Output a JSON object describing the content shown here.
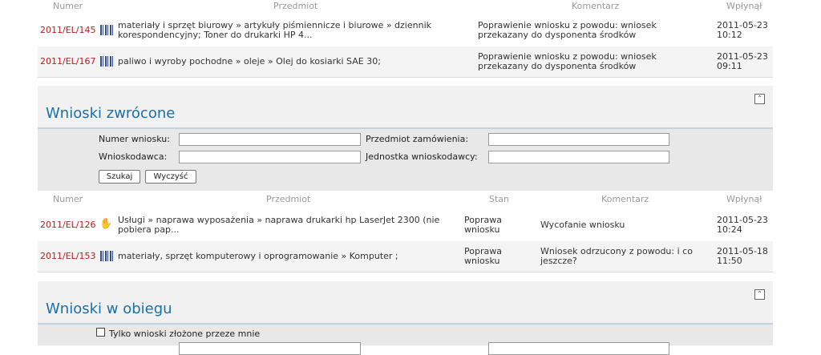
{
  "top_table": {
    "headers": {
      "numer": "Numer",
      "przedmiot": "Przedmiot",
      "komentarz": "Komentarz",
      "wplynal": "Wpłynął"
    },
    "rows": [
      {
        "numer": "2011/EL/145",
        "icon": "barcode-icon",
        "przedmiot_1": "materiały i sprzęt biurowy » artykuły piśmiennicze i biurowe » dziennik",
        "przedmiot_2": "korespondencyjny; Toner do drukarki HP 4...",
        "komentarz_1": "Poprawienie wniosku z powodu: wniosek",
        "komentarz_2": "przekazany do dysponenta środków",
        "date": "2011-05-23",
        "time": "10:12"
      },
      {
        "numer": "2011/EL/167",
        "icon": "barcode-icon",
        "przedmiot_1": "paliwo i wyroby pochodne » oleje » Olej do kosiarki SAE 30;",
        "przedmiot_2": "",
        "komentarz_1": "Poprawienie wniosku z powodu: wniosek",
        "komentarz_2": "przekazany do dysponenta środków",
        "date": "2011-05-23",
        "time": "09:11"
      }
    ]
  },
  "section_zwrocone": {
    "title": "Wnioski zwrócone",
    "collapse_icon": "double-chevron-up-icon",
    "filters": {
      "numer_label": "Numer wniosku:",
      "przedmiot_label": "Przedmiot zamówienia:",
      "wnioskodawca_label": "Wnioskodawca:",
      "jednostka_label": "Jednostka wnioskodawcy:",
      "numer_value": "",
      "przedmiot_value": "",
      "wnioskodawca_value": "",
      "jednostka_value": "",
      "search_button": "Szukaj",
      "clear_button": "Wyczyść"
    },
    "headers": {
      "numer": "Numer",
      "przedmiot": "Przedmiot",
      "stan": "Stan",
      "komentarz": "Komentarz",
      "wplynal": "Wpłynął"
    },
    "rows": [
      {
        "numer": "2011/EL/126",
        "icon": "hand-icon",
        "przedmiot_1": "Usługi » naprawa wyposażenia » naprawa drukarki hp LaserJet 2300 (nie",
        "przedmiot_2": "pobiera pap...",
        "stan_1": "Poprawa",
        "stan_2": "wniosku",
        "komentarz_1": "Wycofanie wniosku",
        "komentarz_2": "",
        "date": "2011-05-23",
        "time": "10:24"
      },
      {
        "numer": "2011/EL/153",
        "icon": "barcode-icon",
        "przedmiot_1": "materiały, sprzęt komputerowy i oprogramowanie » Komputer ;",
        "przedmiot_2": "",
        "stan_1": "Poprawa",
        "stan_2": "wniosku",
        "komentarz_1": "Wniosek odrzucony z powodu: i co",
        "komentarz_2": "jeszcze?",
        "date": "2011-05-18",
        "time": "11:50"
      }
    ]
  },
  "section_obieg": {
    "title": "Wnioski w obiegu",
    "collapse_icon": "double-chevron-up-icon",
    "only_mine_label": "Tylko wnioski złożone przeze mnie"
  }
}
